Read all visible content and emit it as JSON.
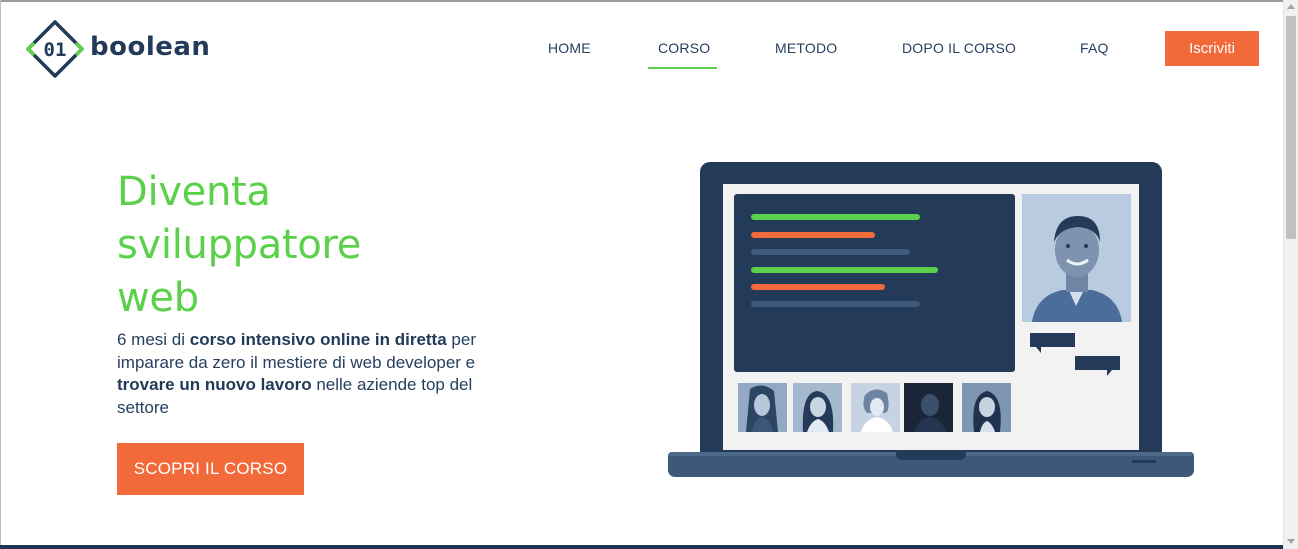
{
  "header": {
    "logo_mark": "01",
    "logo_text": "boolean",
    "nav": [
      {
        "label": "HOME",
        "active": false
      },
      {
        "label": "CORSO",
        "active": true
      },
      {
        "label": "METODO",
        "active": false
      },
      {
        "label": "DOPO IL CORSO",
        "active": false
      },
      {
        "label": "FAQ",
        "active": false
      }
    ],
    "signup_label": "Iscriviti"
  },
  "hero": {
    "title_line1": "Diventa",
    "title_line2": "sviluppatore",
    "title_line3": "web",
    "desc": {
      "p1": "6 mesi di ",
      "b1": "corso intensivo online in diretta",
      "p2": " per imparare da zero il mestiere di web developer e ",
      "b2": "trovare un nuovo lavoro",
      "p3": " nelle aziende top del settore"
    },
    "cta_label": "SCOPRI IL CORSO"
  },
  "colors": {
    "brand_navy": "#233a59",
    "accent_green": "#5bd04a",
    "accent_orange": "#f26a3a"
  }
}
